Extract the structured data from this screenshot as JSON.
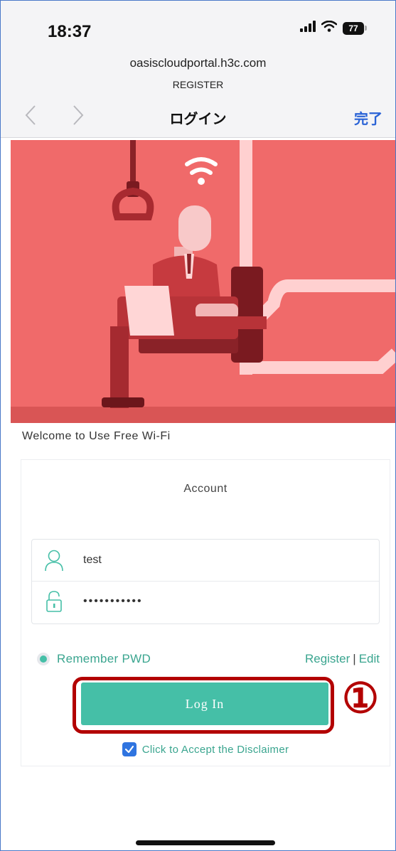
{
  "status_bar": {
    "time": "18:37",
    "battery": "77"
  },
  "browser": {
    "domain": "oasiscloudportal.h3c.com",
    "page_subtitle": "REGISTER",
    "nav_title": "ログイン",
    "done_label": "完了"
  },
  "portal": {
    "welcome": "Welcome to Use Free Wi-Fi",
    "account_title": "Account",
    "username_value": "test",
    "password_value": "•••••••••••",
    "remember_label": "Remember PWD",
    "register_link": "Register",
    "separator": "|",
    "edit_link": "Edit",
    "login_button": "Log In",
    "step_marker": "①",
    "disclaimer_label": "Click to Accept the Disclaimer",
    "disclaimer_checked": true,
    "remember_checked": true
  },
  "colors": {
    "accent": "#45bfa7",
    "accent_text": "#3aa58f",
    "highlight": "#b30000",
    "hero_bg": "#f06a6a",
    "link_blue": "#2a63d6"
  },
  "icons": [
    "signal-icon",
    "wifi-icon",
    "battery-icon",
    "back-chevron-icon",
    "forward-chevron-icon",
    "user-icon",
    "lock-icon",
    "checkbox-checked-icon"
  ]
}
